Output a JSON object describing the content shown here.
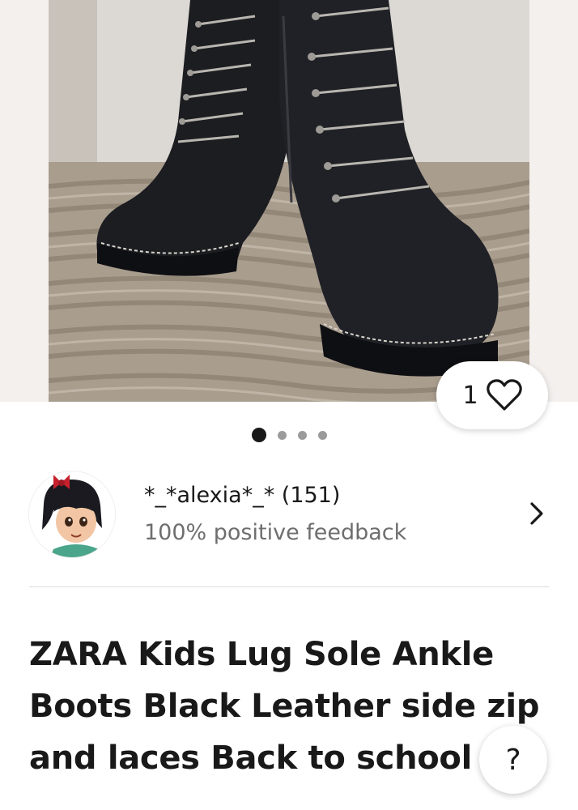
{
  "gallery": {
    "watch_count": "1",
    "image_count": 4,
    "active_index": 0
  },
  "seller": {
    "name": "*_*alexia*_* (151)",
    "feedback": "100% positive feedback"
  },
  "listing": {
    "title": "ZARA Kids Lug Sole Ankle Boots Black Leather side zip and laces Back to school"
  },
  "help": {
    "label": "?"
  },
  "icons": {
    "watch": "heart-icon",
    "seller_link": "chevron-right-icon"
  }
}
